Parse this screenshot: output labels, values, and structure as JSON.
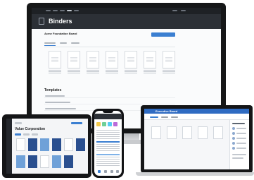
{
  "monitor": {
    "app_title": "Binders",
    "page_title": "Acme Foundation Board",
    "section_title": "Templates"
  },
  "tablet": {
    "page_title": "Value Corporation"
  },
  "laptop": {
    "window_title": "Executive Board"
  },
  "colors": {
    "accent": "#3b7fd1",
    "header_dark": "#2c3036",
    "laptop_titlebar": "#2f6bc2"
  }
}
